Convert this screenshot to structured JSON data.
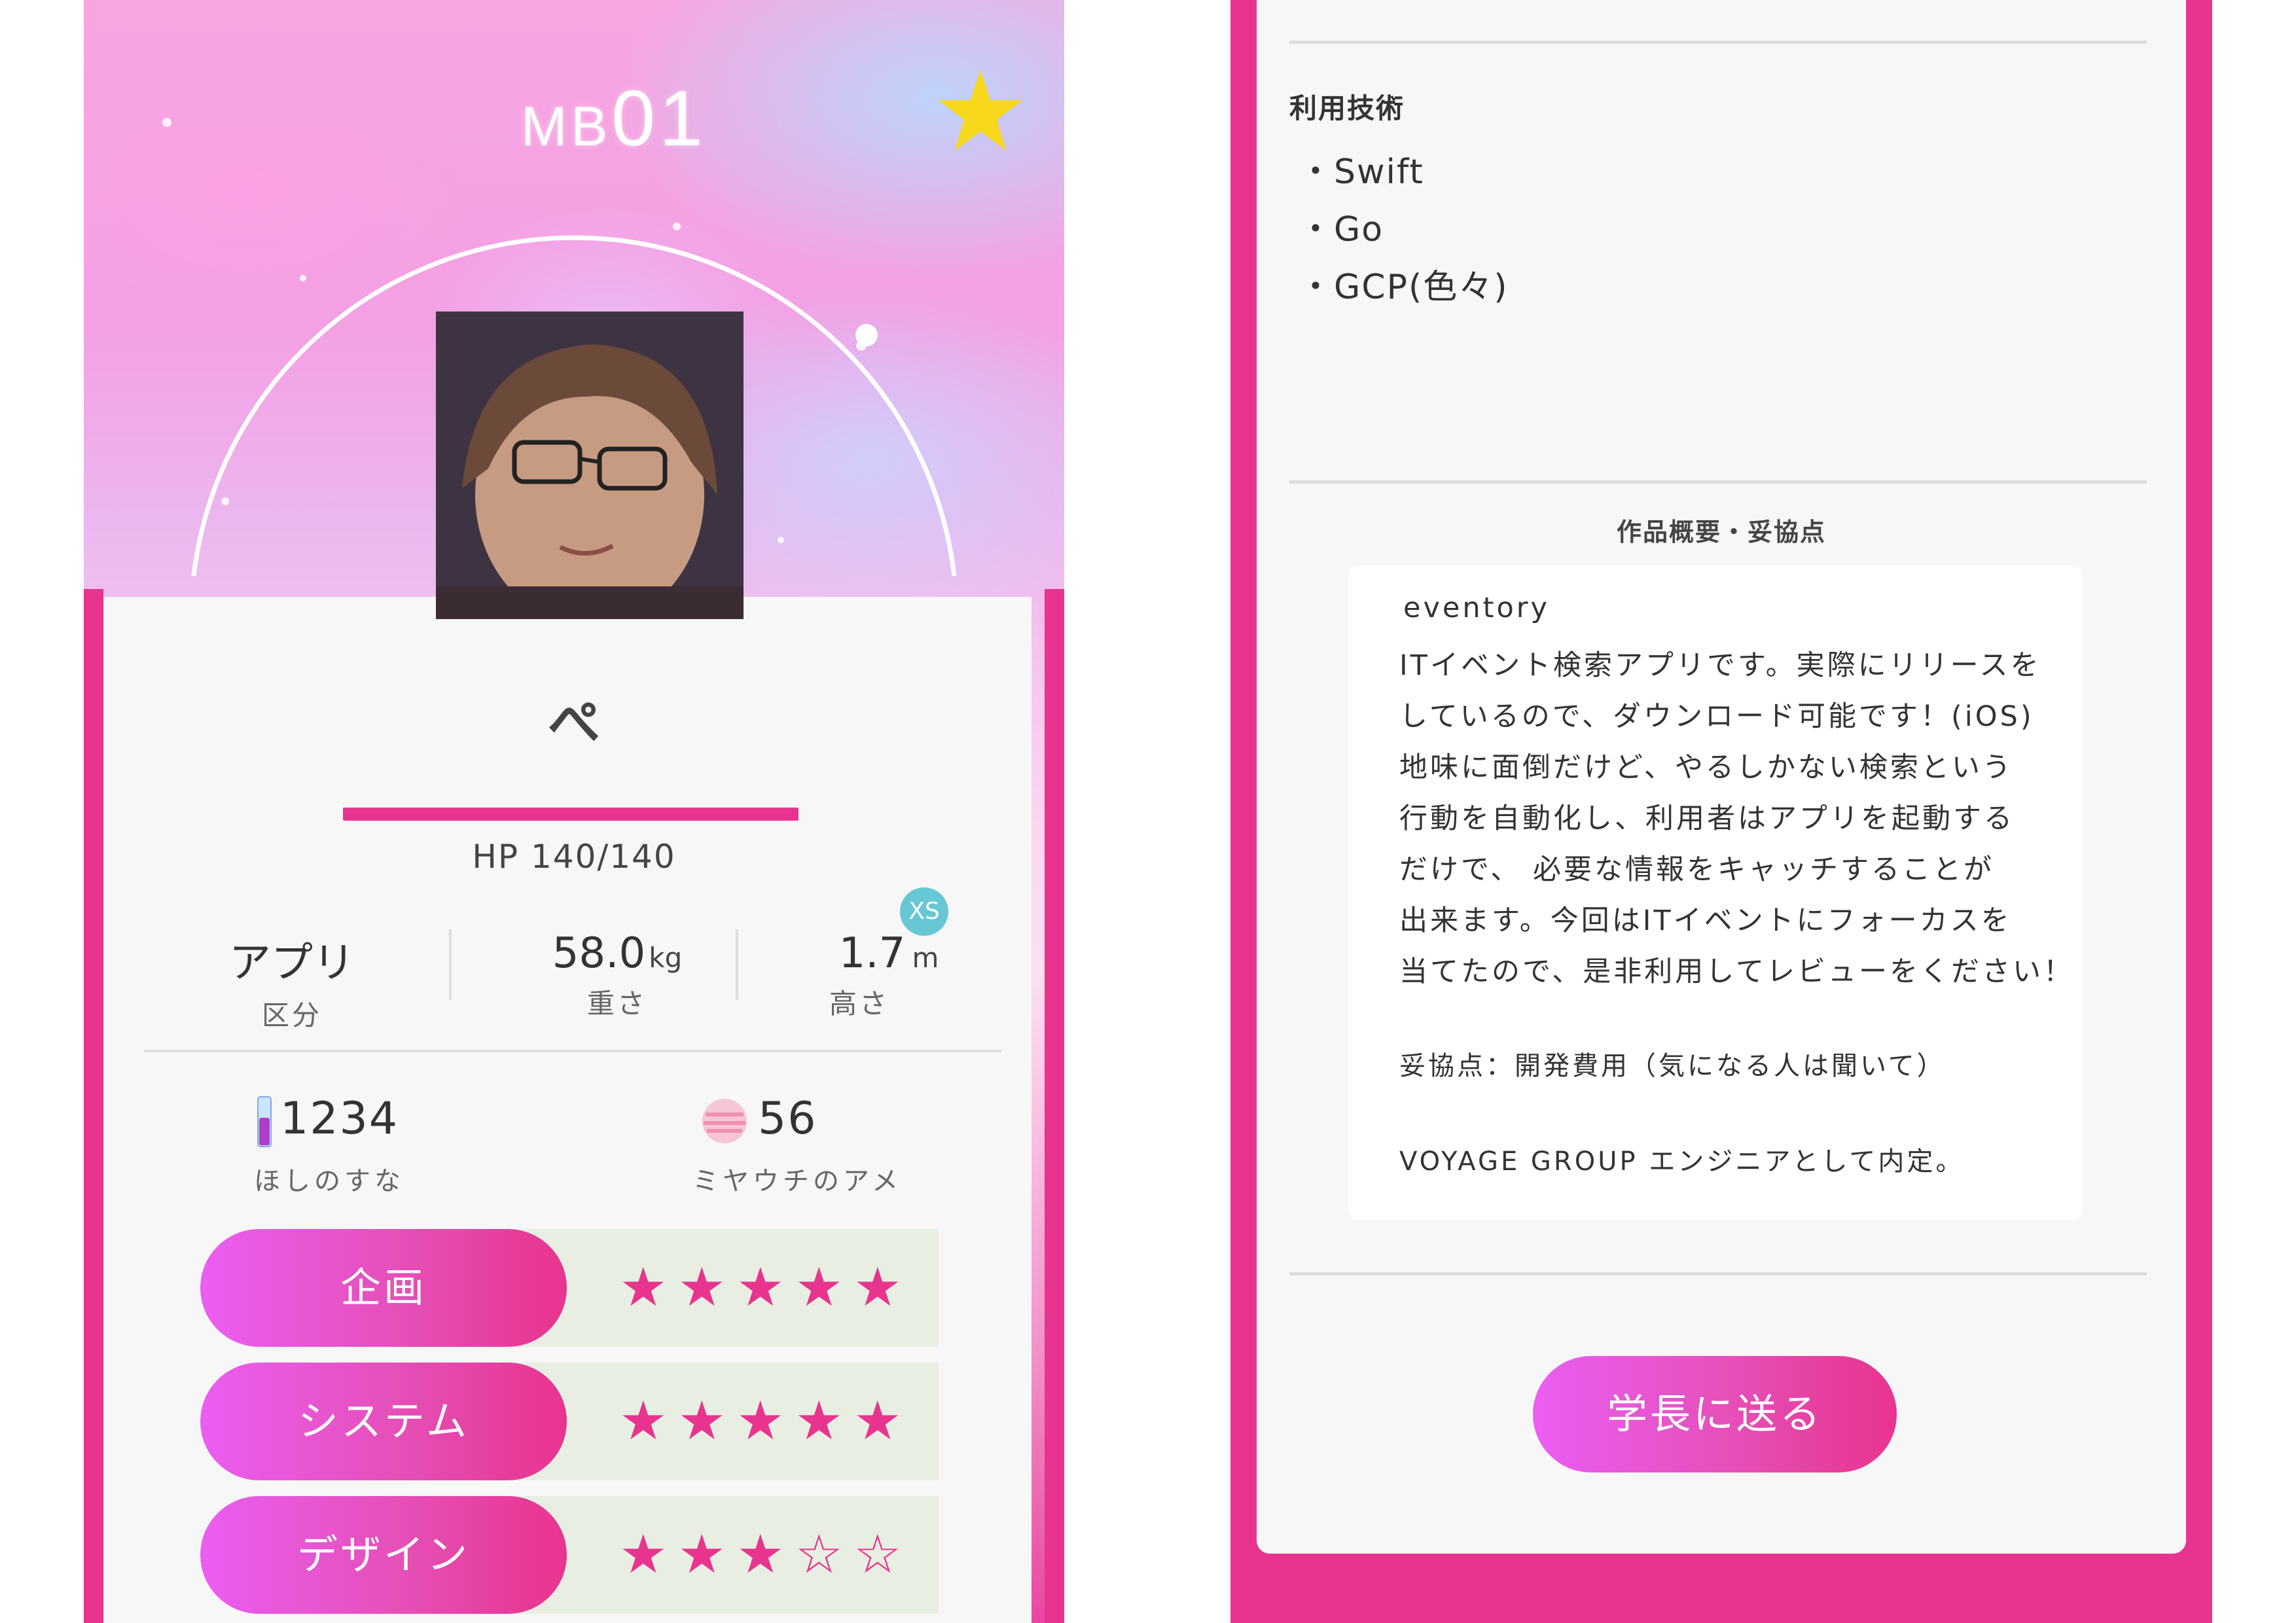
{
  "profile": {
    "code_prefix": "MB",
    "code_number": "01",
    "name": "ぺ",
    "hp": "HP 140/140",
    "hp_fraction": 1.0,
    "favorite": true
  },
  "stats": {
    "category": {
      "value": "アプリ",
      "label": "区分"
    },
    "weight": {
      "value": "58.0",
      "unit": "kg",
      "label": "重さ"
    },
    "height": {
      "value": "1.7",
      "unit": "m",
      "label": "高さ",
      "badge": "XS"
    }
  },
  "resources": {
    "stardust": {
      "value": "1234",
      "label": "ほしのすな"
    },
    "candy": {
      "value": "56",
      "label": "ミヤウチのアメ"
    }
  },
  "skills": [
    {
      "label": "企画",
      "stars": "★★★★★",
      "rating": 5
    },
    {
      "label": "システム",
      "stars": "★★★★★",
      "rating": 5
    },
    {
      "label": "デザイン",
      "stars": "★★★☆☆",
      "rating": 3
    }
  ],
  "tech": {
    "title": "利用技術",
    "items": [
      "・Swift",
      "・Go",
      "・GCP(色々)"
    ]
  },
  "summary": {
    "title": "作品概要・妥協点",
    "lines": [
      "eventory",
      "ITイベント検索アプリです。実際にリリースを",
      "しているので、ダウンロード可能です！(iOS)",
      "地味に面倒だけど、やるしかない検索という",
      "行動を自動化し、利用者はアプリを起動する",
      "だけで、 必要な情報をキャッチすることが",
      "出来ます。今回はITイベントにフォーカスを",
      "当てたので、是非利用してレビューをください！",
      "妥協点：開発費用（気になる人は聞いて）",
      "VOYAGE GROUP エンジニアとして内定。"
    ]
  },
  "actions": {
    "send_label": "学長に送る"
  },
  "colors": {
    "accent": "#e8348f",
    "star_gold": "#f8d81c",
    "badge": "#67c7d4"
  }
}
